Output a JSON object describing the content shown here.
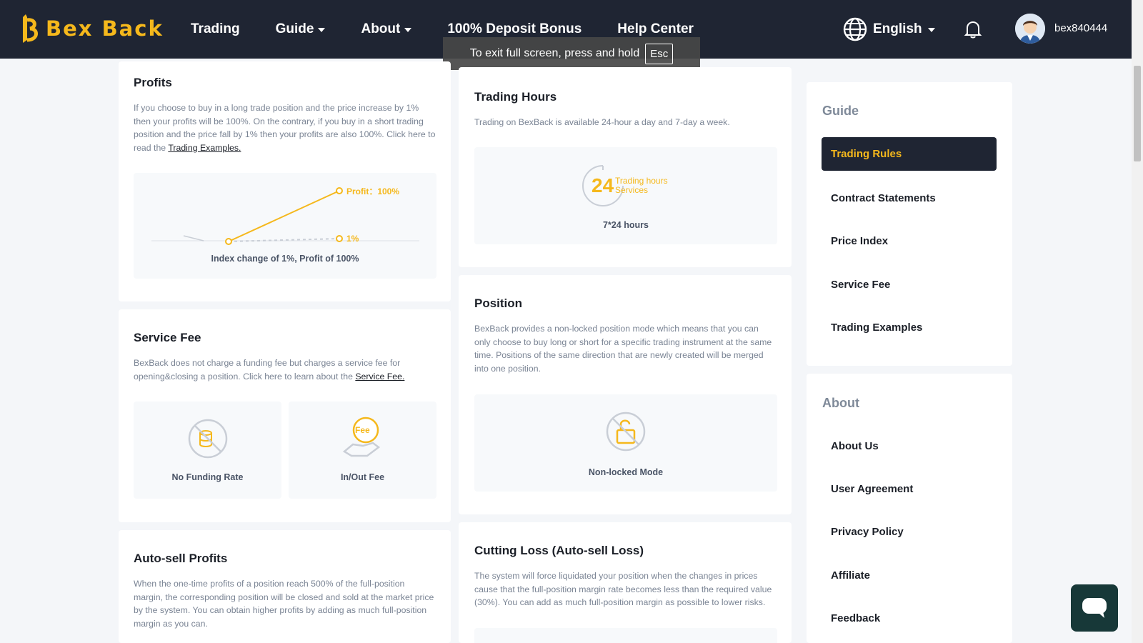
{
  "header": {
    "logo_text": "Bex Back",
    "nav": [
      {
        "label": "Trading"
      },
      {
        "label": "Guide"
      },
      {
        "label": "About"
      },
      {
        "label": "100% Deposit Bonus"
      },
      {
        "label": "Help Center"
      }
    ],
    "language": "English",
    "username": "bex840444"
  },
  "fullscreen_notice": {
    "text": "To exit full screen, press and hold",
    "key": "Esc"
  },
  "profits": {
    "title": "Profits",
    "body": "If you choose to buy in a long trade position and the price increase by 1% then your profits will be 100%. On the contrary, if you buy in a short trading position and the price fall by 1% then your profits are also 100%. Click here to read the ",
    "link": "Trading Examples.",
    "chart_profit_label": "Profit：100%",
    "chart_change_label": "1%",
    "caption": "Index change of 1%, Profit of 100%"
  },
  "service_fee": {
    "title": "Service Fee",
    "body": "BexBack does not charge a funding fee but charges a service fee for opening&closing a position. Click here to learn about the ",
    "link": "Service Fee.",
    "tile1": "No Funding Rate",
    "tile2": "In/Out Fee",
    "tile2_icon_text": "Fee"
  },
  "auto_sell": {
    "title": "Auto-sell Profits",
    "body": "When the one-time profits of a position reach 500% of the full-position margin, the corresponding position will be closed and sold at the market price by the system. You can obtain higher profits by adding as much full-position margin as you can."
  },
  "trading_hours": {
    "title": "Trading Hours",
    "body": "Trading on BexBack is available 24-hour a day and 7-day a week.",
    "badge_number": "24",
    "badge_line1": "Trading hours",
    "badge_line2": "Services",
    "caption": "7*24 hours"
  },
  "position": {
    "title": "Position",
    "body": "BexBack provides a non-locked position mode which means that you can only choose to buy long or short for a specific trading instrument at the same time. Positions of the same direction that are newly created will be merged into one position.",
    "caption": "Non-locked Mode"
  },
  "cutting_loss": {
    "title": "Cutting Loss (Auto-sell Loss)",
    "body": "The system will force liquidated your position when the changes in prices cause that the full-position margin rate becomes less than the required value (30%). You can add as much full-position margin as possible to lower risks."
  },
  "sidebar": {
    "guide_title": "Guide",
    "guide_items": [
      {
        "label": "Trading Rules"
      },
      {
        "label": "Contract Statements"
      },
      {
        "label": "Price Index"
      },
      {
        "label": "Service Fee"
      },
      {
        "label": "Trading Examples"
      }
    ],
    "about_title": "About",
    "about_items": [
      {
        "label": "About Us"
      },
      {
        "label": "User Agreement"
      },
      {
        "label": "Privacy Policy"
      },
      {
        "label": "Affiliate"
      },
      {
        "label": "Feedback"
      }
    ]
  },
  "colors": {
    "accent": "#f5b81c",
    "header_bg": "#1f2533",
    "chat_bg": "#173838"
  }
}
